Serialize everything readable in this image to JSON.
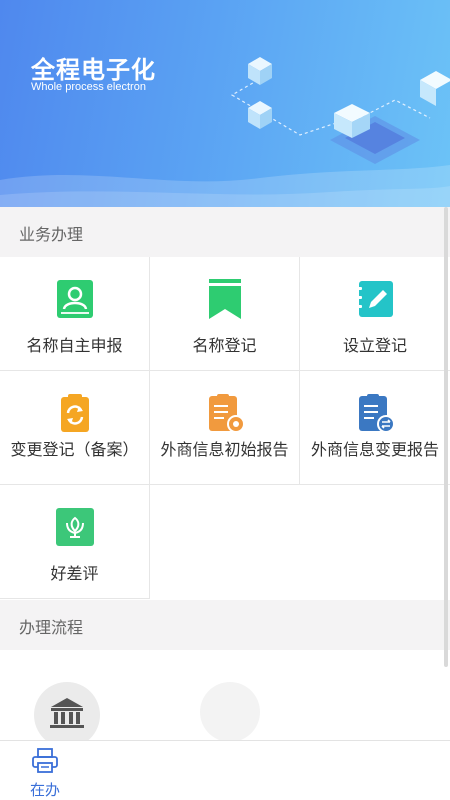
{
  "banner": {
    "title": "全程电子化",
    "subtitle": "Whole process electron"
  },
  "sections": {
    "business": "业务办理",
    "process": "办理流程"
  },
  "services": [
    {
      "label": "名称自主申报",
      "icon": "id-card-icon"
    },
    {
      "label": "名称登记",
      "icon": "bookmark-icon"
    },
    {
      "label": "设立登记",
      "icon": "edit-notebook-icon"
    },
    {
      "label": "变更登记（备案）",
      "icon": "refresh-clipboard-icon"
    },
    {
      "label": "外商信息初始报告",
      "icon": "report-clock-icon"
    },
    {
      "label": "外商信息变更报告",
      "icon": "report-exchange-icon"
    },
    {
      "label": "好差评",
      "icon": "flower-rating-icon"
    }
  ],
  "bottom_nav": {
    "active_label": "在办",
    "icon": "printer-icon"
  },
  "colors": {
    "banner_start": "#4f88ee",
    "banner_end": "#6cc3f7",
    "green": "#2ecc71",
    "orange": "#f5a623",
    "blue": "#3b78c2",
    "nav_active": "#3a6fd8"
  }
}
